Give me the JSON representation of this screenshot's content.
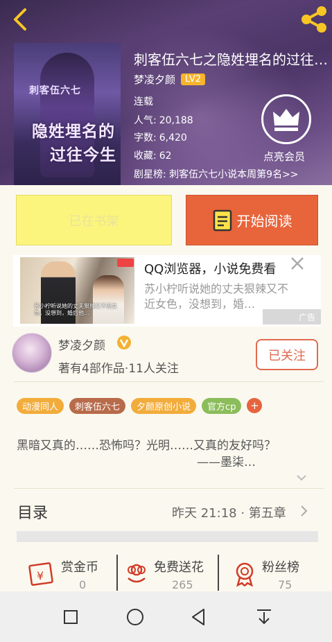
{
  "header": {
    "title": "刺客伍六七之隐姓埋名的过往…",
    "author": "梦凌夕颜",
    "level_badge": "LV2",
    "status": "连载",
    "stats": [
      {
        "label": "人气:",
        "value": "20,188"
      },
      {
        "label": "字数:",
        "value": "6,420"
      },
      {
        "label": "收藏:",
        "value": "62"
      }
    ],
    "rank_text": "剧星榜: 刺客伍六七小说本周第9名>>",
    "vip_label": "点亮会员",
    "cover": {
      "line1": "刺客伍六七",
      "line2": "隐姓埋名的",
      "line3": "过往今生"
    }
  },
  "actions": {
    "shelf_label": "已在书架",
    "read_label": "开始阅读"
  },
  "ad": {
    "title": "QQ浏览器，小说免费看",
    "desc": "苏小柠听说她的丈夫狠辣又不近女色，没想到，婚…",
    "label": "广告",
    "image_caption": "苏小柠听说她的丈夫狠辣又不近女色，没想到，婚后他…"
  },
  "author": {
    "name": "梦凌夕颜",
    "stats": "著有4部作品·11人关注",
    "follow_label": "已关注"
  },
  "tags": [
    {
      "label": "动漫同人",
      "color": "#f2ac3b"
    },
    {
      "label": "刺客伍六七",
      "color": "#b86b4a"
    },
    {
      "label": "夕颜原创小说",
      "color": "#f2ac3b"
    },
    {
      "label": "官方cp",
      "color": "#8bbd5a"
    }
  ],
  "tag_add": "+",
  "description": {
    "line1": "黑暗又真的……恐怖吗？光明……又真的友好吗？",
    "line2": "——墨柒…"
  },
  "toc": {
    "label": "目录",
    "status": "昨天 21:18 · 第五章"
  },
  "stats_row": [
    {
      "label": "赏金币",
      "value": "0"
    },
    {
      "label": "免费送花",
      "value": "265"
    },
    {
      "label": "粉丝榜",
      "value": "75"
    }
  ],
  "colors": {
    "accent": "#e8643a",
    "shelf": "#fbf57e",
    "gold": "#f6b52e"
  }
}
